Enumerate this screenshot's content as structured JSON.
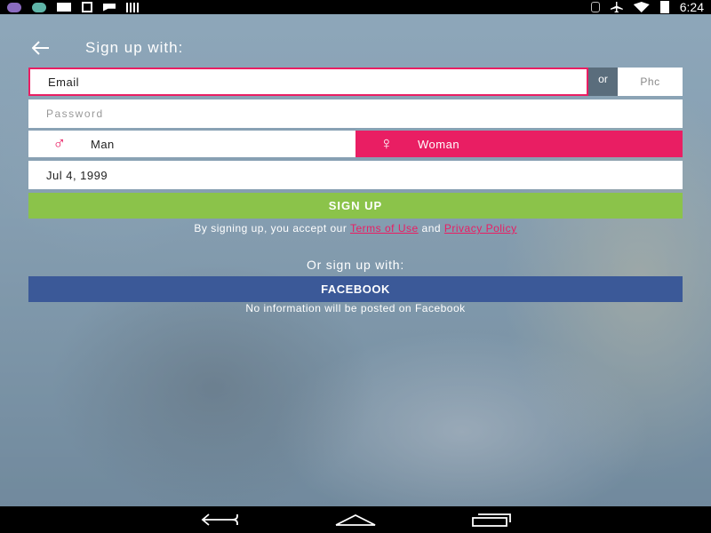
{
  "status_bar": {
    "time": "6:24",
    "left_icons": [
      "app-icon",
      "app-icon",
      "mail-icon",
      "download-icon",
      "message-icon",
      "barcode-icon"
    ],
    "right_icons": [
      "bluetooth-icon",
      "airplane-mode-icon",
      "wifi-icon",
      "battery-icon"
    ]
  },
  "header": {
    "title": "Sign up with:",
    "back_icon": "arrow-left-icon"
  },
  "form": {
    "email_placeholder": "Email",
    "or_label": "or",
    "phone_placeholder": "Phc",
    "password_placeholder": "Password",
    "gender": {
      "man_label": "Man",
      "woman_label": "Woman",
      "man_icon": "male-symbol-icon",
      "woman_icon": "female-symbol-icon",
      "selected": "Woman"
    },
    "birth_date": "Jul 4, 1999",
    "signup_label": "SIGN UP"
  },
  "terms": {
    "prefix": "By signing up, you accept our",
    "terms_link": "Terms of Use",
    "and": "and",
    "privacy_link": "Privacy Policy"
  },
  "social": {
    "or_signup": "Or sign up with:",
    "facebook_label": "FACEBOOK",
    "facebook_note": "No information will be posted on Facebook"
  },
  "nav_bar": {
    "buttons": [
      "back-nav-icon",
      "home-nav-icon",
      "recents-nav-icon"
    ]
  },
  "colors": {
    "accent": "#e91e63",
    "signup_green": "#8bc34a",
    "facebook_blue": "#3b5998"
  }
}
